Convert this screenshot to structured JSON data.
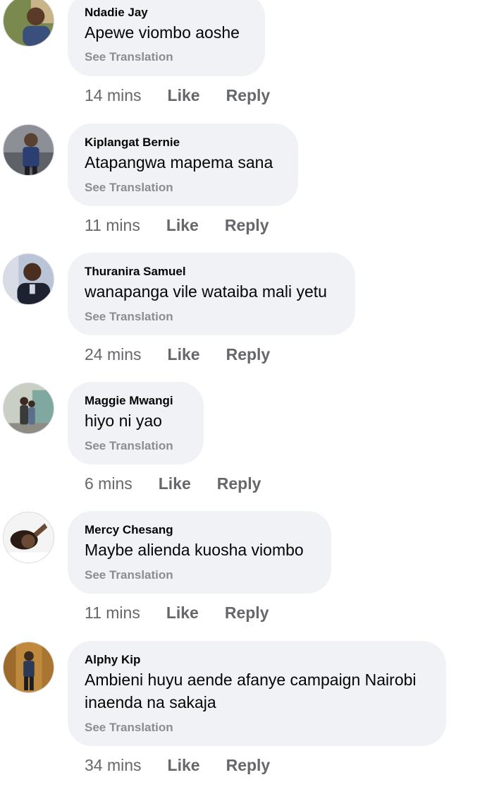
{
  "comments": [
    {
      "author": "Ndadie Jay",
      "text": "Apewe viombo aoshe",
      "see_translation": "See Translation",
      "time": "14 mins",
      "like_label": "Like",
      "reply_label": "Reply",
      "avatar_colors": [
        "#7a8a4e",
        "#3b4f7d",
        "#d9c3a5"
      ]
    },
    {
      "author": "Kiplangat Bernie",
      "text": "Atapangwa mapema sana",
      "see_translation": "See Translation",
      "time": "11 mins",
      "like_label": "Like",
      "reply_label": "Reply",
      "avatar_colors": [
        "#8c8f96",
        "#2b3f73",
        "#5a4030"
      ]
    },
    {
      "author": "Thuranira Samuel",
      "text": "wanapanga vile wataiba mali yetu",
      "see_translation": "See Translation",
      "time": "24 mins",
      "like_label": "Like",
      "reply_label": "Reply",
      "avatar_colors": [
        "#b9c4d6",
        "#1e2230",
        "#4a2e20"
      ]
    },
    {
      "author": "Maggie Mwangi",
      "text": "hiyo ni yao",
      "see_translation": "See Translation",
      "time": "6 mins",
      "like_label": "Like",
      "reply_label": "Reply",
      "avatar_colors": [
        "#c9cfc4",
        "#7fa9a0",
        "#3a3a3a"
      ]
    },
    {
      "author": "Mercy Chesang",
      "text": "Maybe alienda kuosha viombo",
      "see_translation": "See Translation",
      "time": "11 mins",
      "like_label": "Like",
      "reply_label": "Reply",
      "avatar_colors": [
        "#f4f4f4",
        "#2a1c14",
        "#6b4a35"
      ]
    },
    {
      "author": "Alphy Kip",
      "text": "Ambieni huyu aende afanye campaign Nairobi inaenda na sakaja",
      "see_translation": "See Translation",
      "time": "34 mins",
      "like_label": "Like",
      "reply_label": "Reply",
      "avatar_colors": [
        "#c08a3e",
        "#2c3a55",
        "#3b2a20"
      ]
    }
  ]
}
